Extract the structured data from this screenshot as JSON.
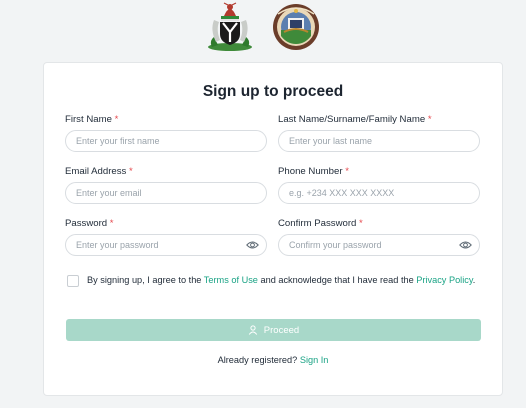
{
  "header": {
    "logos": [
      "nigeria-coat-of-arms-icon",
      "state-seal-icon"
    ]
  },
  "form": {
    "title": "Sign up to proceed",
    "required_marker": "*",
    "first_name": {
      "label": "First Name",
      "placeholder": "Enter your first name",
      "value": ""
    },
    "last_name": {
      "label": "Last Name/Surname/Family Name",
      "placeholder": "Enter your last name",
      "value": ""
    },
    "email": {
      "label": "Email Address",
      "placeholder": "Enter your email",
      "value": ""
    },
    "phone": {
      "label": "Phone Number",
      "placeholder": "e.g. +234 XXX XXX XXXX",
      "value": ""
    },
    "password": {
      "label": "Password",
      "placeholder": "Enter your password",
      "value": "",
      "icon": "eye-icon"
    },
    "confirm_password": {
      "label": "Confirm Password",
      "placeholder": "Confirm your password",
      "value": "",
      "icon": "eye-icon"
    },
    "consent": {
      "checked": false,
      "text_before": "By signing up, I agree to the ",
      "terms_link": "Terms of Use",
      "text_middle": " and acknowledge that I have read the ",
      "privacy_link": "Privacy Policy",
      "text_after": "."
    },
    "proceed_button": {
      "label": "Proceed",
      "icon": "user-icon"
    },
    "signin": {
      "prompt": "Already registered? ",
      "link": "Sign In"
    }
  },
  "colors": {
    "accent": "#1aa385",
    "button_disabled": "#a8d8c9",
    "required": "#e5484d",
    "page_bg": "#f2f4f5"
  }
}
